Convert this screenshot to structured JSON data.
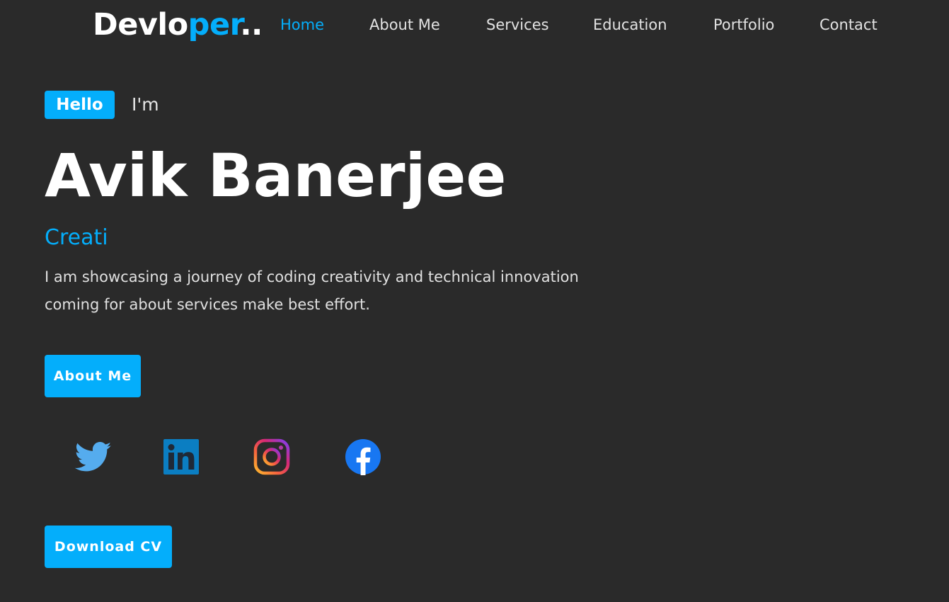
{
  "logo": {
    "text_main": "Devlo",
    "text_accent": "per",
    "text_tail": ".."
  },
  "nav": {
    "items": [
      {
        "label": "Home",
        "active": true
      },
      {
        "label": "About Me",
        "active": false
      },
      {
        "label": "Services",
        "active": false
      },
      {
        "label": "Education",
        "active": false
      },
      {
        "label": "Portfolio",
        "active": false
      },
      {
        "label": "Contact",
        "active": false
      }
    ]
  },
  "hero": {
    "badge": "Hello",
    "intro": "I'm",
    "name": "Avik Banerjee",
    "typing": "Creati",
    "description": "I am showcasing a journey of coding creativity and technical innovation coming for about services make best effort."
  },
  "buttons": {
    "about": "About Me",
    "cv": "Download CV"
  },
  "social": [
    {
      "icon": "twitter-icon",
      "color": "#55acee"
    },
    {
      "icon": "linkedin-icon",
      "color": "#0077b5"
    },
    {
      "icon": "instagram-icon",
      "color": "#d62976"
    },
    {
      "icon": "facebook-icon",
      "color": "#1877f2"
    }
  ],
  "colors": {
    "accent": "#04aefb",
    "background": "#2a2a2a",
    "text": "#ffffff"
  }
}
